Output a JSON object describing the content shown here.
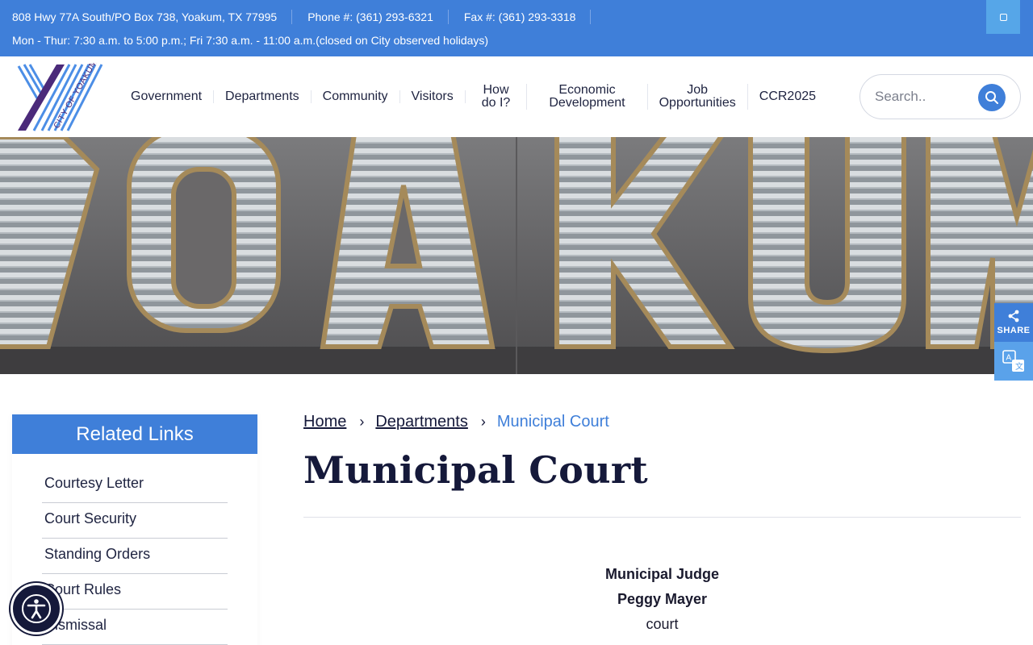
{
  "topbar": {
    "address": "808 Hwy 77A South/PO Box 738, Yoakum, TX 77995",
    "phone": "Phone #: (361) 293-6321",
    "fax": "Fax #: (361) 293-3318",
    "hours": "Mon - Thur:  7:30 a.m. to 5:00 p.m.; Fri 7:30 a.m. - 11:00 a.m.(closed on City observed holidays)"
  },
  "logo": {
    "text": "CITY OF YOAKUM"
  },
  "nav": {
    "items": [
      {
        "label": "Government"
      },
      {
        "label": "Departments"
      },
      {
        "label": "Community"
      },
      {
        "label": "Visitors"
      },
      {
        "label": "How\ndo I?"
      },
      {
        "label": "Economic\nDevelopment"
      },
      {
        "label": "Job\nOpportunities"
      },
      {
        "label": "CCR2025"
      }
    ]
  },
  "search": {
    "placeholder": "Search.."
  },
  "share": {
    "label": "SHARE"
  },
  "sidebar": {
    "title": "Related Links",
    "items": [
      {
        "label": "Courtesy Letter"
      },
      {
        "label": "Court Security"
      },
      {
        "label": "Standing Orders"
      },
      {
        "label": "Court Rules"
      },
      {
        "label": "Dismissal"
      }
    ]
  },
  "breadcrumb": {
    "home": "Home",
    "departments": "Departments",
    "current": "Municipal Court"
  },
  "page": {
    "title": "Municipal Court",
    "judge_title": "Municipal Judge",
    "judge_name": "Peggy Mayer",
    "caption": "court"
  },
  "colors": {
    "accent": "#3f7fd9",
    "dark": "#15193a",
    "logo_purple": "#4b2a7a",
    "logo_blue": "#4c8ee6"
  }
}
